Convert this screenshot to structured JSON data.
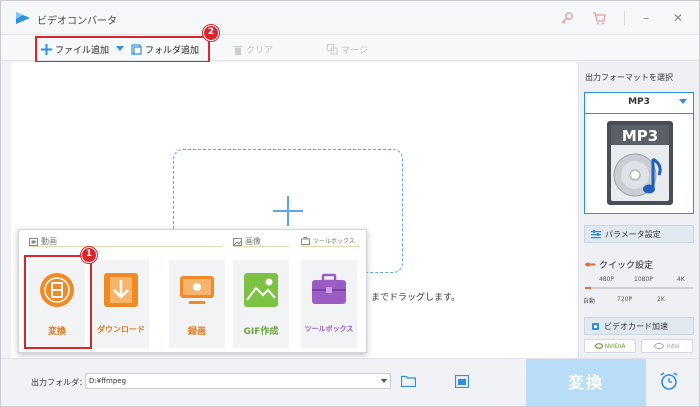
{
  "app": {
    "title": "ビデオコンバータ"
  },
  "toolbar": {
    "add_file": "ファイル追加",
    "add_folder": "フォルダ追加",
    "clear": "クリア",
    "merge": "マージ"
  },
  "badges": {
    "one": "1",
    "two": "2"
  },
  "drop": {
    "hint": "までドラッグします。"
  },
  "popup": {
    "video_section": "動画",
    "image_section": "画像",
    "toolbox_section": "ツールボックス",
    "tiles": [
      {
        "label": "変換",
        "icon": "film-convert-icon"
      },
      {
        "label": "ダウンロード",
        "icon": "download-icon"
      },
      {
        "label": "録画",
        "icon": "screen-record-icon"
      },
      {
        "label": "GIF作成",
        "icon": "gif-image-icon"
      },
      {
        "label": "ツールボックス",
        "icon": "toolbox-icon"
      }
    ]
  },
  "right_panel": {
    "title": "出力フォーマットを選択",
    "format": "MP3",
    "format_badge": "MP3",
    "params_button": "パラメータ設定",
    "quick_settings": "クイック設定",
    "ticks_top": [
      "480P",
      "1080P",
      "4K"
    ],
    "ticks_bottom": [
      "自動",
      "720P",
      "2K"
    ],
    "gpu_button": "ビデオカード加速",
    "nvidia": "NVIDIA",
    "intel": "Intel"
  },
  "bottom": {
    "output_label": "出力フォルダ：",
    "output_path": "D:¥ffmpeg",
    "convert": "変換"
  },
  "colors": {
    "accent_blue": "#2e8fe0",
    "highlight_red": "#d9262c",
    "tile_orange": "#f08a24",
    "tile_green": "#7cc243",
    "tile_purple": "#9b5cc4",
    "convert_disabled": "#b9ddf6"
  }
}
